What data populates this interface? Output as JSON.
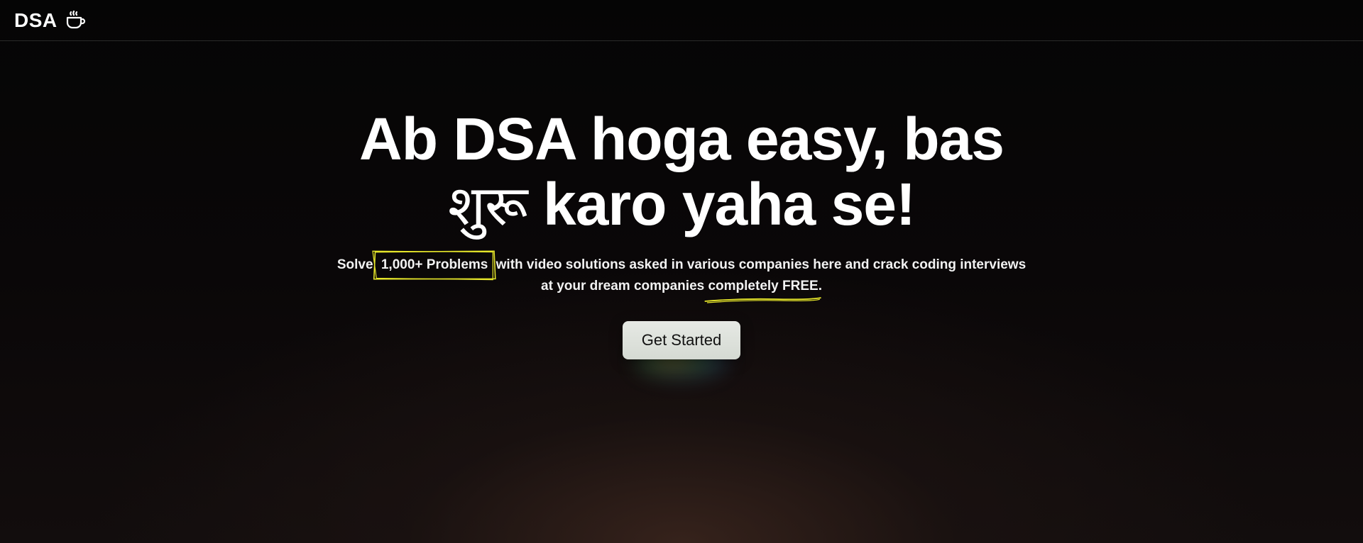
{
  "navbar": {
    "brand_text": "DSA",
    "brand_icon": "coffee-cup-icon"
  },
  "hero": {
    "title_line1": "Ab DSA hoga easy, bas",
    "title_line2_devanagari": "शुरू",
    "title_line2_rest": " karo yaha se!",
    "subtitle_pre": "Solve ",
    "subtitle_highlight": "1,000+ Problems",
    "subtitle_mid": " with video solutions asked in various companies here and crack coding interviews at your dream companies ",
    "subtitle_underline": "completely FREE",
    "subtitle_end": ".",
    "cta_label": "Get Started"
  },
  "colors": {
    "accent_yellow": "#e6e62a",
    "background": "#000000",
    "button_bg": "#dfe3dd"
  }
}
